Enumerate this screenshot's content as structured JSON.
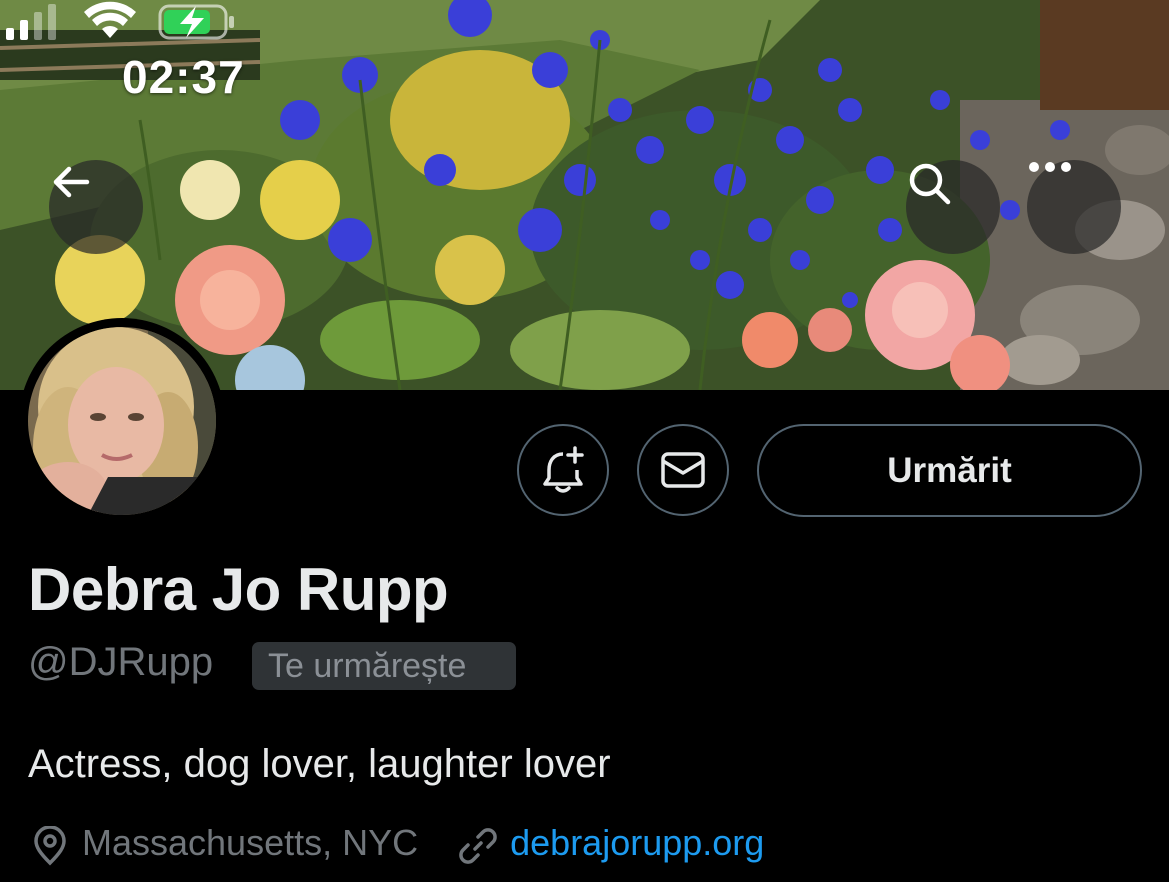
{
  "status_bar": {
    "time": "02:37",
    "battery_color": "#30d158"
  },
  "nav": {
    "back_icon": "arrow-left-icon",
    "search_icon": "search-icon",
    "more_icon": "more-horizontal-icon"
  },
  "profile": {
    "name": "Debra Jo Rupp",
    "handle": "@DJRupp",
    "follows_you_badge": "Te urmărește",
    "bio": "Actress, dog lover, laughter lover",
    "location": "Massachusetts, NYC",
    "website": "debrajorupp.org"
  },
  "actions": {
    "notify_icon": "bell-plus-icon",
    "message_icon": "envelope-icon",
    "follow_label": "Urmărit"
  },
  "colors": {
    "background": "#000000",
    "text": "#e7e9ea",
    "secondary_text": "#71767b",
    "link": "#1d9bf0",
    "border": "#536471"
  }
}
